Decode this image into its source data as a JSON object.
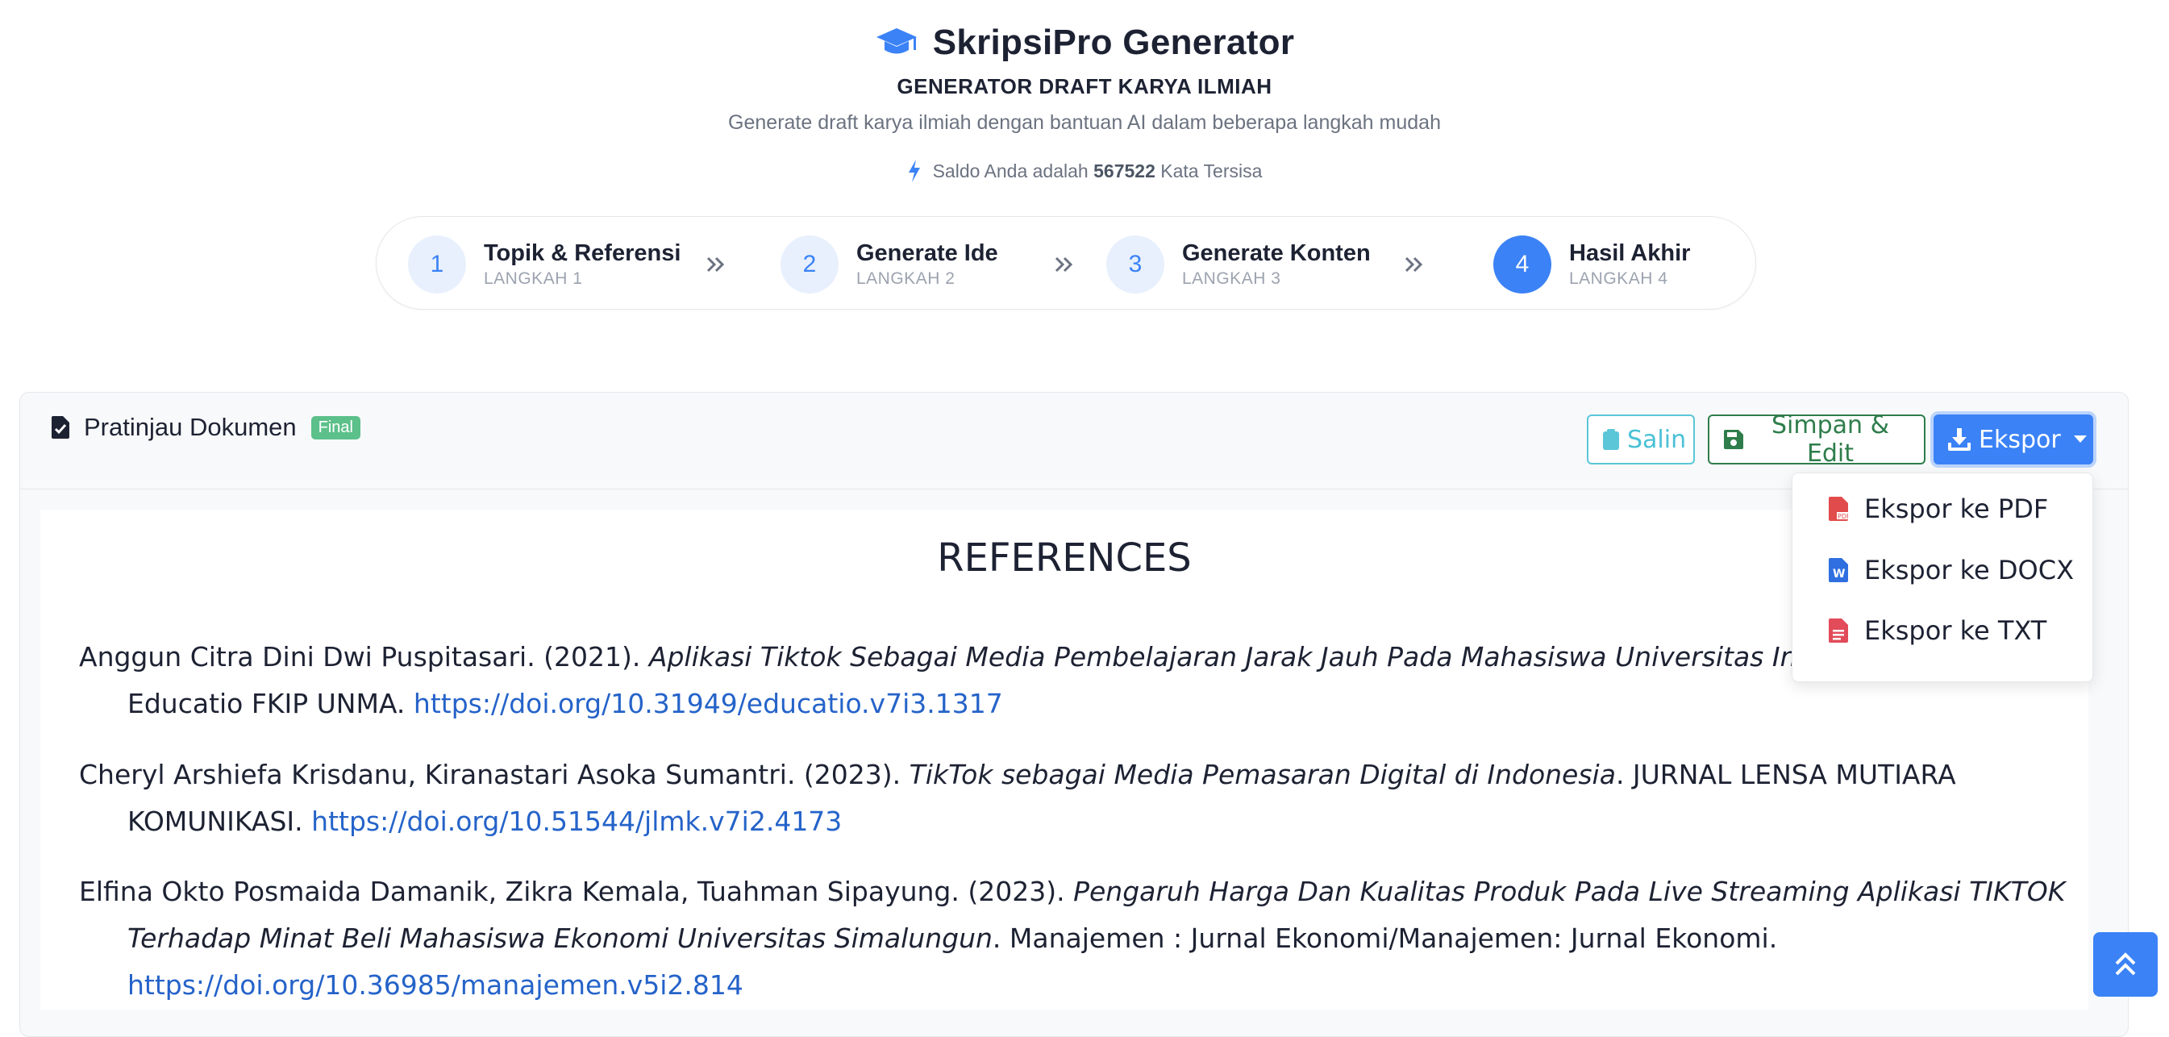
{
  "header": {
    "brand_title": "SkripsiPro Generator",
    "subtitle": "GENERATOR DRAFT KARYA ILMIAH",
    "tagline": "Generate draft karya ilmiah dengan bantuan AI dalam beberapa langkah mudah",
    "saldo_prefix": "Saldo Anda adalah",
    "saldo_value": "567522",
    "saldo_suffix": "Kata Tersisa"
  },
  "steps": [
    {
      "number": "1",
      "title": "Topik & Referensi",
      "sub": "LANGKAH 1"
    },
    {
      "number": "2",
      "title": "Generate Ide",
      "sub": "LANGKAH 2"
    },
    {
      "number": "3",
      "title": "Generate Konten",
      "sub": "LANGKAH 3"
    },
    {
      "number": "4",
      "title": "Hasil Akhir",
      "sub": "LANGKAH 4"
    }
  ],
  "document": {
    "title": "Pratinjau Dokumen",
    "badge": "Final",
    "buttons": {
      "salin": "Salin",
      "simpan": "Simpan & Edit",
      "ekspor": "Ekspor"
    },
    "heading": "REFERENCES",
    "references": [
      {
        "authors": "Anggun Citra Dini Dwi Puspitasari. (2021). ",
        "title": "Aplikasi Tiktok Sebagai Media Pembelajaran Jarak Jauh Pada Mahasiswa Universitas Indraprasta PGRI",
        "journal": ". Educatio FKIP UNMA. ",
        "doi": "https://doi.org/10.31949/educatio.v7i3.1317"
      },
      {
        "authors": "Cheryl Arshiefa Krisdanu, Kiranastari Asoka Sumantri. (2023). ",
        "title": "TikTok sebagai Media Pemasaran Digital di Indonesia",
        "journal": ". JURNAL LENSA MUTIARA KOMUNIKASI. ",
        "doi": "https://doi.org/10.51544/jlmk.v7i2.4173"
      },
      {
        "authors": "Elfina Okto Posmaida Damanik, Zikra Kemala, Tuahman Sipayung. (2023). ",
        "title": "Pengaruh Harga Dan Kualitas Produk Pada Live Streaming Aplikasi TIKTOK Terhadap Minat Beli Mahasiswa Ekonomi Universitas Simalungun",
        "journal": ". Manajemen : Jurnal Ekonomi/Manajemen: Jurnal Ekonomi. ",
        "doi": "https://doi.org/10.36985/manajemen.v5i2.814"
      }
    ]
  },
  "export_menu": [
    {
      "label": "Ekspor ke PDF",
      "icon": "pdf-file-icon",
      "color": "#e24b4b"
    },
    {
      "label": "Ekspor ke DOCX",
      "icon": "docx-file-icon",
      "color": "#2f6fe0"
    },
    {
      "label": "Ekspor ke TXT",
      "icon": "txt-file-icon",
      "color": "#e24b5a"
    }
  ],
  "colors": {
    "accent": "#3b82f6",
    "success": "#5cc08a",
    "info": "#4ac1d6",
    "save": "#2e7d4b"
  }
}
